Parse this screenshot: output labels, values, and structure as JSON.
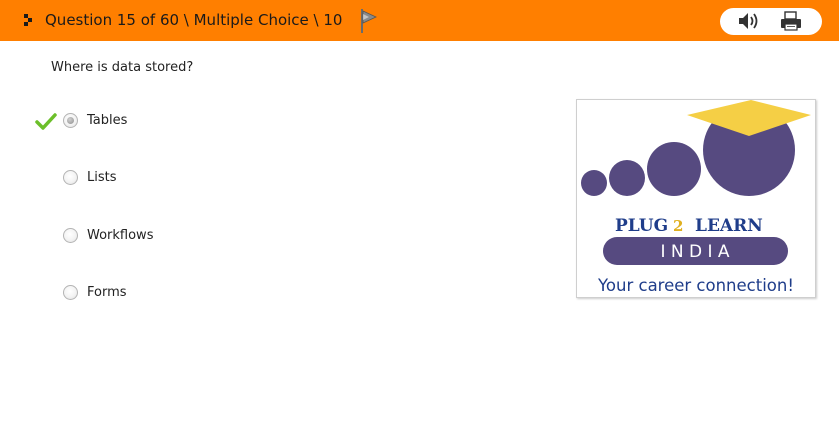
{
  "header": {
    "title": "Question 15 of 60 \\ Multiple Choice \\ 10",
    "icons": {
      "drag": "drag-handle-icon",
      "flag": "flag-icon",
      "audio": "speaker-icon",
      "print": "printer-icon"
    }
  },
  "question": {
    "text": "Where is data stored?",
    "options": [
      {
        "label": "Tables",
        "selected": true,
        "correct": true
      },
      {
        "label": "Lists",
        "selected": false
      },
      {
        "label": "Workflows",
        "selected": false
      },
      {
        "label": "Forms",
        "selected": false
      }
    ]
  },
  "logo": {
    "line1_left": "PLUG",
    "line1_mid": "2",
    "line1_right": "LEARN",
    "line2": "I N D I A",
    "tagline": "Your career connection!"
  },
  "colors": {
    "header_bg": "#ff7f00",
    "check": "#6cbf2a",
    "logo_purple": "#564a80",
    "logo_gold": "#f5cf45",
    "logo_blue": "#1f3d8a"
  }
}
